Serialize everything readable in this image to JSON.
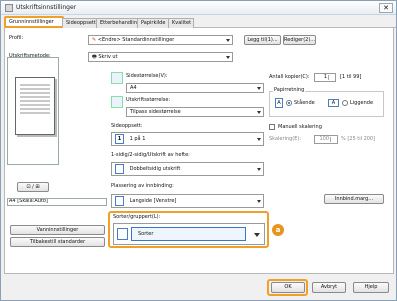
{
  "window": {
    "title": "Utskriftsinnstillinger",
    "close": "✕"
  },
  "tabs": [
    {
      "label": "Grunninnstillinger"
    },
    {
      "label": "Sideoppsett"
    },
    {
      "label": "Etterbehandling"
    },
    {
      "label": "Papirkilde"
    },
    {
      "label": "Kvalitet"
    }
  ],
  "profile": {
    "label": "Profil:",
    "value": "<Endre> Standardinnstillinger",
    "add_button": "Legg til(1)...",
    "edit_button": "Rediger(2)..."
  },
  "output_method": {
    "label": "Utskriftsmetode:",
    "value": "Skriv ut"
  },
  "preview": {
    "caption": "A4 [Skala:Auto]",
    "view_button": "⊡ / ⊞"
  },
  "page_size": {
    "label": "Sidestørrelse(V):",
    "value": "A4"
  },
  "output_size": {
    "label": "Utskriftsstørrelse:",
    "value": "Tilpass sidestørrelse"
  },
  "layout": {
    "label": "Sideoppsett:",
    "icon_text": "1",
    "value": "1 på 1"
  },
  "duplex": {
    "label": "1-sidig/2-sidig/Utskrift av hefte:",
    "value": "Dobbeltsidig utskrift"
  },
  "binding": {
    "label": "Plassering av innbinding:",
    "value": "Langside [Venstre]",
    "margin_button": "Innbind.marg..."
  },
  "collate": {
    "label": "Sorter/gruppert(L):",
    "value": "Sorter",
    "badge": "a"
  },
  "copies": {
    "label": "Antall kopier(C):",
    "value": "1",
    "range": "[1 til 99]"
  },
  "orientation": {
    "label": "Papirretning",
    "portrait_icon": "A",
    "portrait": "Stående",
    "landscape_icon": "A",
    "landscape": "Liggende"
  },
  "scaling": {
    "label": "Manuell skalering",
    "field_label": "Skalering(E):",
    "value": "100",
    "range": "% [25 til 200]"
  },
  "left_buttons": {
    "watermark": "Vanninnstillinger",
    "restore": "Tilbakestill standarder"
  },
  "footer": {
    "ok": "OK",
    "cancel": "Avbryt",
    "help": "Hjelp"
  },
  "colors": {
    "highlight": "#f0a028",
    "badge": "#e89520"
  }
}
